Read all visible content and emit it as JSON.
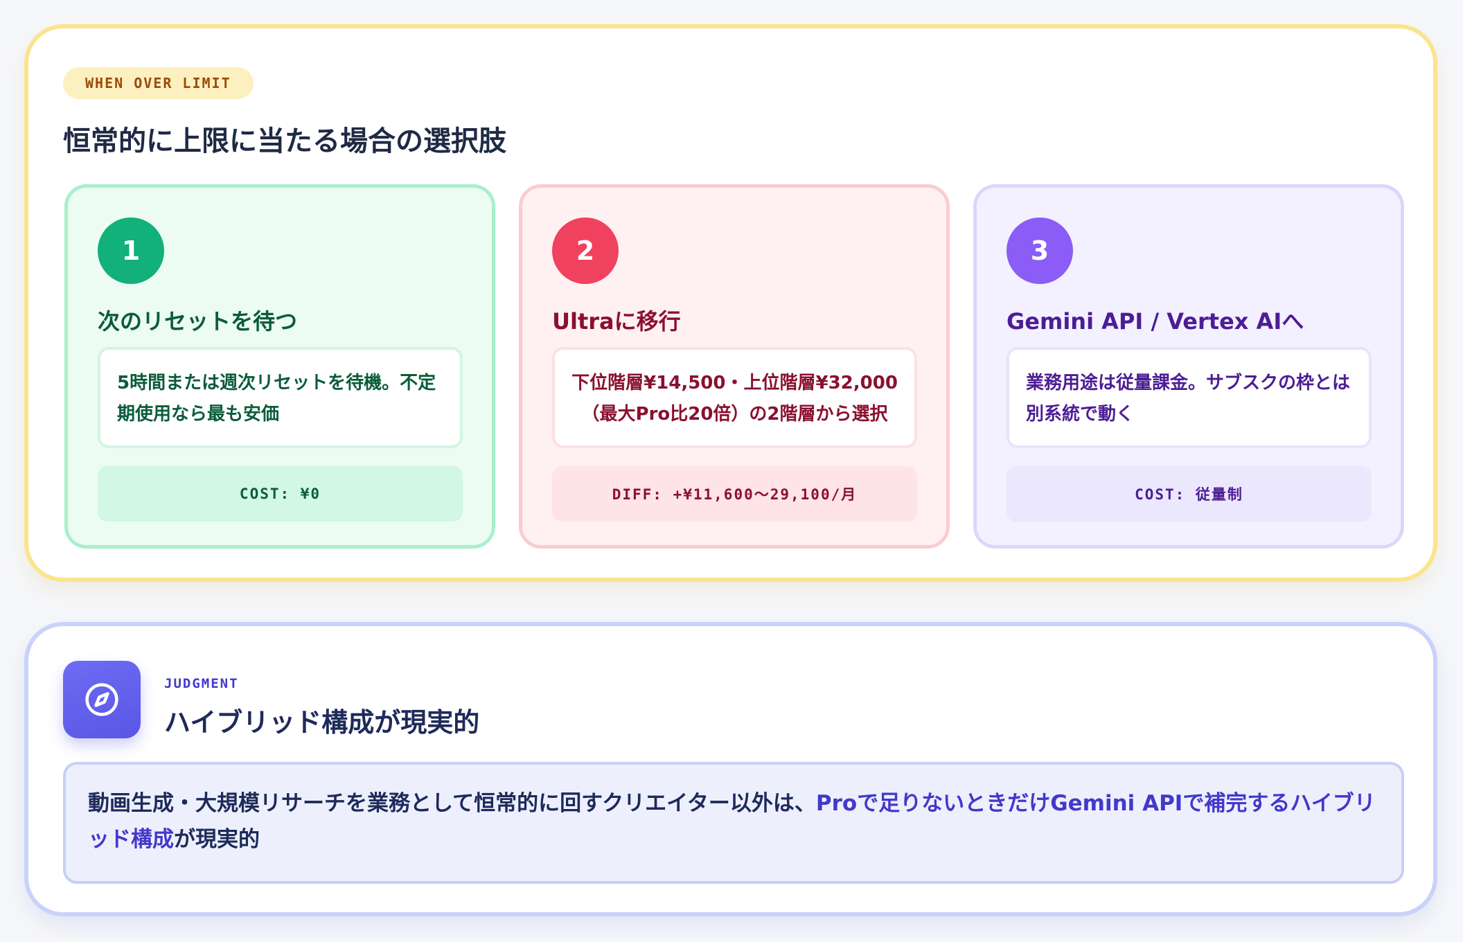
{
  "limit_section": {
    "eyebrow": "WHEN OVER LIMIT",
    "title": "恒常的に上限に当たる場合の選択肢",
    "options": [
      {
        "number": "1",
        "title": "次のリセットを待つ",
        "description": "5時間または週次リセットを待機。不定期使用なら最も安価",
        "cost": "COST: ¥0",
        "accent": "#12b07a"
      },
      {
        "number": "2",
        "title": "Ultraに移行",
        "description": "下位階層¥14,500・上位階層¥32,000（最大Pro比20倍）の2階層から選択",
        "cost": "DIFF: +¥11,600〜29,100/月",
        "accent": "#f0415e"
      },
      {
        "number": "3",
        "title": "Gemini API / Vertex AIへ",
        "description": "業務用途は従量課金。サブスクの枠とは別系統で動く",
        "cost": "COST: 従量制",
        "accent": "#8b5cf6"
      }
    ]
  },
  "judgment": {
    "icon": "compass-icon",
    "eyebrow": "JUDGMENT",
    "title": "ハイブリッド構成が現実的",
    "body_lead": "動画生成・大規模リサーチを業務として恒常的に回すクリエイター以外は、",
    "body_highlight": "Proで足りないときだけGemini APIで補完するハイブリッド構成",
    "body_tail": "が現実的",
    "accent": "#4338ca"
  }
}
